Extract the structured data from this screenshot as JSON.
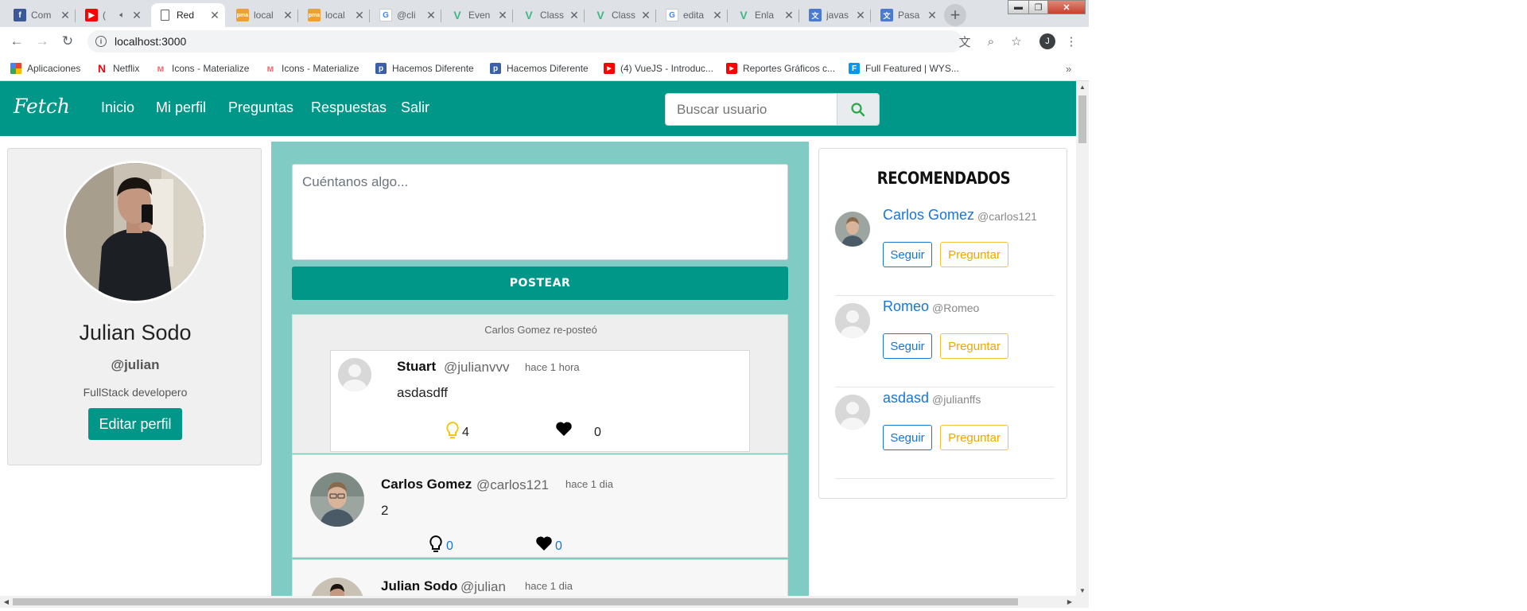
{
  "browser": {
    "tabs": [
      {
        "title": "Com",
        "icon": "facebook-icon",
        "color": "#3b5998"
      },
      {
        "title": "(",
        "icon": "youtube-icon",
        "color": "#ff0000"
      },
      {
        "title": "Red",
        "icon": "page-icon",
        "color": "#ffffff",
        "active": true
      },
      {
        "title": "local",
        "icon": "phpmyadmin-icon",
        "color": "#f0a030"
      },
      {
        "title": "local",
        "icon": "phpmyadmin-icon",
        "color": "#f0a030"
      },
      {
        "title": "@cli",
        "icon": "google-icon",
        "color": "#4285f4"
      },
      {
        "title": "Even",
        "icon": "vue-icon",
        "color": "#41b883"
      },
      {
        "title": "Class",
        "icon": "vue-icon",
        "color": "#41b883"
      },
      {
        "title": "Class",
        "icon": "vue-icon",
        "color": "#41b883"
      },
      {
        "title": "edita",
        "icon": "google-icon",
        "color": "#4285f4"
      },
      {
        "title": "Enla",
        "icon": "vue-icon",
        "color": "#41b883"
      },
      {
        "title": "javas",
        "icon": "translate-icon",
        "color": "#4a7bd0"
      },
      {
        "title": "Pasa",
        "icon": "translate-icon",
        "color": "#4a7bd0"
      }
    ],
    "url": "localhost:3000",
    "profile_initial": "J",
    "bookmarks": [
      {
        "label": "Aplicaciones",
        "icon": "apps-grid-icon",
        "color": "#d93025"
      },
      {
        "label": "Netflix",
        "icon": "netflix-icon",
        "color": "#e50914"
      },
      {
        "label": "Icons - Materialize",
        "icon": "materialize-icon",
        "color": "#ee6e73"
      },
      {
        "label": "Icons - Materialize",
        "icon": "materialize-icon",
        "color": "#ee6e73"
      },
      {
        "label": "Hacemos Diferente",
        "icon": "platzi-icon",
        "color": "#3b5fa8"
      },
      {
        "label": "Hacemos Diferente",
        "icon": "platzi-icon",
        "color": "#3b5fa8"
      },
      {
        "label": "(4) VueJS - Introduc...",
        "icon": "youtube-icon",
        "color": "#ff0000"
      },
      {
        "label": "Reportes Gráficos c...",
        "icon": "youtube-icon",
        "color": "#ff0000"
      },
      {
        "label": "Full Featured | WYS...",
        "icon": "froala-icon",
        "color": "#0098f7"
      }
    ]
  },
  "app": {
    "brand": "Fetch",
    "nav": [
      "Inicio",
      "Mi perfil",
      "Preguntas",
      "Respuestas",
      "Salir"
    ],
    "search_placeholder": "Buscar usuario",
    "accent": "#009688"
  },
  "profile": {
    "name": "Julian Sodo",
    "handle": "@julian",
    "bio": "FullStack developero",
    "edit_label": "Editar perfil"
  },
  "compose": {
    "placeholder": "Cuéntanos algo...",
    "post_label": "POSTEAR"
  },
  "repost": {
    "label": "Carlos Gomez re-posteó",
    "post": {
      "name": "Stuart",
      "handle": "@julianvvv",
      "time": "hace 1 hora",
      "text": "asdasdff",
      "ideas": "4",
      "likes": "0"
    }
  },
  "posts": [
    {
      "name": "Carlos Gomez",
      "handle": "@carlos121",
      "time": "hace 1 dia",
      "text": "2",
      "ideas": "0",
      "likes": "0"
    },
    {
      "name": "Julian Sodo",
      "handle": "@julian",
      "time": "hace 1 dia"
    }
  ],
  "recommended": {
    "title": "RECOMENDADOS",
    "follow_label": "Seguir",
    "ask_label": "Preguntar",
    "users": [
      {
        "name": "Carlos Gomez",
        "handle": "@carlos121",
        "avatar": "photo"
      },
      {
        "name": "Romeo",
        "handle": "@Romeo",
        "avatar": "default"
      },
      {
        "name": "asdasd",
        "handle": "@julianffs",
        "avatar": "default"
      }
    ]
  }
}
